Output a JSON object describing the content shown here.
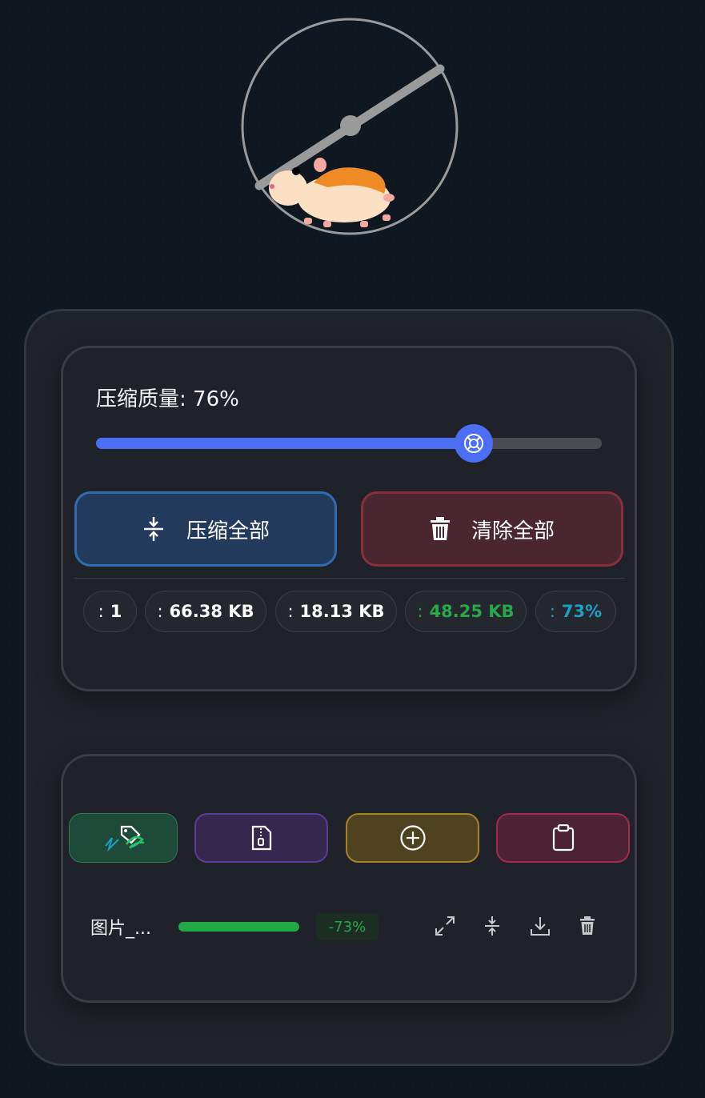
{
  "controls": {
    "quality_label": "压缩质量: 76%",
    "quality_value": 0.76,
    "compress_all_label": "压缩全部",
    "clear_all_label": "清除全部"
  },
  "stats": [
    {
      "prefix": ":",
      "value": "1",
      "color": "#ffffff"
    },
    {
      "prefix": ":",
      "value": "66.38 KB",
      "color": "#ffffff"
    },
    {
      "prefix": ":",
      "value": "18.13 KB",
      "color": "#ffffff"
    },
    {
      "prefix": ":",
      "value": "48.25 KB",
      "color": "#27a84a"
    },
    {
      "prefix": ":",
      "value": "73%",
      "color": "#1aa1c4"
    }
  ],
  "tools": [
    {
      "icon": "tag-icon",
      "color": "#1f4a3a"
    },
    {
      "icon": "zip-file-icon",
      "color": "#34284e"
    },
    {
      "icon": "plus-circle-icon",
      "color": "#4e4220"
    },
    {
      "icon": "clipboard-icon",
      "color": "#4c2234"
    }
  ],
  "file": {
    "name": "图片_...",
    "progress": 1.0,
    "saving": "-73%"
  },
  "colors": {
    "accent": "#4b6ef5",
    "success": "#27a84a",
    "danger": "#8a2d3c"
  }
}
